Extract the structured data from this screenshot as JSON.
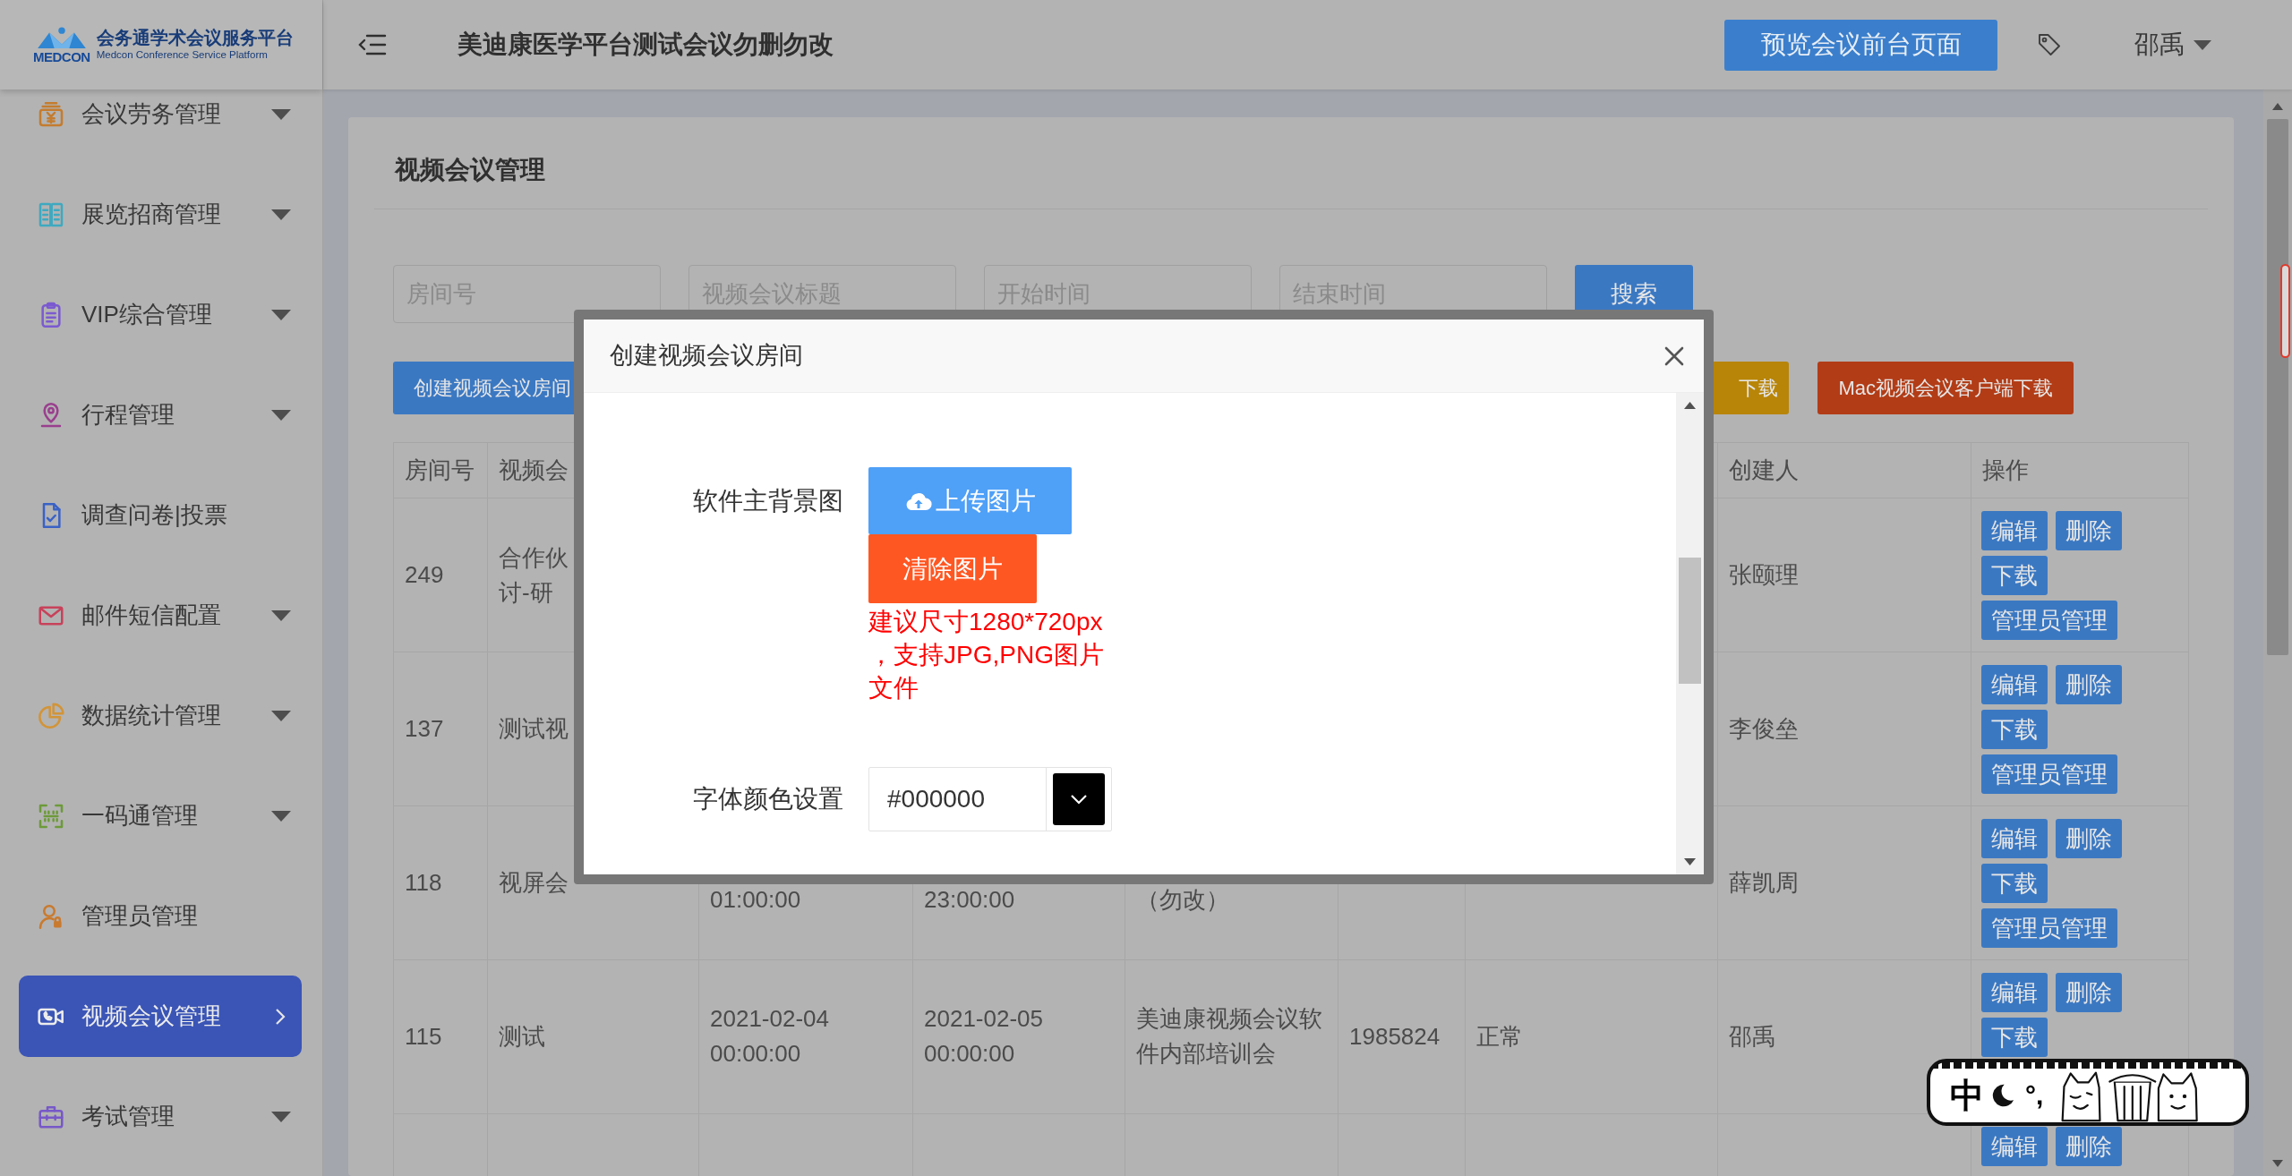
{
  "brand": {
    "mark": "MEDCON",
    "name": "会务通学术会议服务平台",
    "subtitle": "Medcon Conference Service Platform"
  },
  "sidebar": {
    "items": [
      {
        "label": "会议劳务管理",
        "color": "#c47c2f",
        "has_submenu": true,
        "selected": false
      },
      {
        "label": "展览招商管理",
        "color": "#3ea9c0",
        "has_submenu": true,
        "selected": false
      },
      {
        "label": "VIP综合管理",
        "color": "#7b5ad0",
        "has_submenu": true,
        "selected": false
      },
      {
        "label": "行程管理",
        "color": "#9a3f8e",
        "has_submenu": true,
        "selected": false
      },
      {
        "label": "调查问卷|投票",
        "color": "#3a62c6",
        "has_submenu": false,
        "selected": false
      },
      {
        "label": "邮件短信配置",
        "color": "#c8425a",
        "has_submenu": true,
        "selected": false
      },
      {
        "label": "数据统计管理",
        "color": "#d29438",
        "has_submenu": true,
        "selected": false
      },
      {
        "label": "一码通管理",
        "color": "#6d9a3a",
        "has_submenu": true,
        "selected": false
      },
      {
        "label": "管理员管理",
        "color": "#c97a2e",
        "has_submenu": false,
        "selected": false
      },
      {
        "label": "视频会议管理",
        "has_submenu": false,
        "selected": true
      },
      {
        "label": "考试管理",
        "color": "#7758c8",
        "has_submenu": true,
        "selected": false
      }
    ]
  },
  "header": {
    "title": "美迪康医学平台测试会议勿删勿改",
    "preview_button": "预览会议前台页面",
    "user": "邵禹"
  },
  "page": {
    "title": "视频会议管理",
    "filters": [
      {
        "placeholder": "房间号"
      },
      {
        "placeholder": "视频会议标题"
      },
      {
        "placeholder": "开始时间"
      },
      {
        "placeholder": "结束时间"
      }
    ],
    "search_button": "搜索",
    "actions": [
      {
        "kind": "create",
        "label": "创建视频会议房间"
      },
      {
        "kind": "download",
        "label": "下载"
      },
      {
        "kind": "client_download",
        "label": "Mac视频会议客户端下载"
      }
    ],
    "table": {
      "header": {
        "column_1": "房间号",
        "column_2": "视频会",
        "column_8": "创建人",
        "column_9": "操作"
      },
      "rows": [
        {
          "column_1": "249",
          "column_2": "合作伙讨-研",
          "column_8": "张颐理",
          "actions": [
            "编辑",
            "删除",
            "下载",
            "管理员管理"
          ]
        },
        {
          "column_1": "137",
          "column_2": "测试视",
          "column_8": "李俊垒",
          "actions": [
            "编辑",
            "删除",
            "下载",
            "管理员管理"
          ]
        },
        {
          "column_1": "118",
          "column_2": "视屏会",
          "column_3": "01:00:00",
          "column_4": "23:00:00",
          "column_5": "（勿改）",
          "column_8": "薛凯周",
          "actions": [
            "编辑",
            "删除",
            "下载",
            "管理员管理"
          ]
        },
        {
          "column_1": "115",
          "column_2": "测试",
          "column_3": "2021-02-04 00:00:00",
          "column_4": "2021-02-05 00:00:00",
          "column_5": "美迪康视频会议软件内部培训会",
          "column_6": "1985824",
          "column_7": "正常",
          "column_8": "邵禹",
          "actions": [
            "编辑",
            "删除",
            "下载"
          ]
        },
        {
          "actions": [
            "编辑",
            "删除"
          ]
        }
      ]
    }
  },
  "modal": {
    "title": "创建视频会议房间",
    "fields": [
      {
        "kind": "image",
        "label": "软件主背景图",
        "upload_button": "上传图片",
        "clear_button": "清除图片",
        "hint": "建议尺寸1280*720px，支持JPG,PNG图片文件"
      },
      {
        "kind": "color",
        "label": "字体颜色设置",
        "value": "#000000"
      }
    ]
  },
  "ime_toolbar": {
    "mode": "中",
    "punctuation": "°,"
  }
}
